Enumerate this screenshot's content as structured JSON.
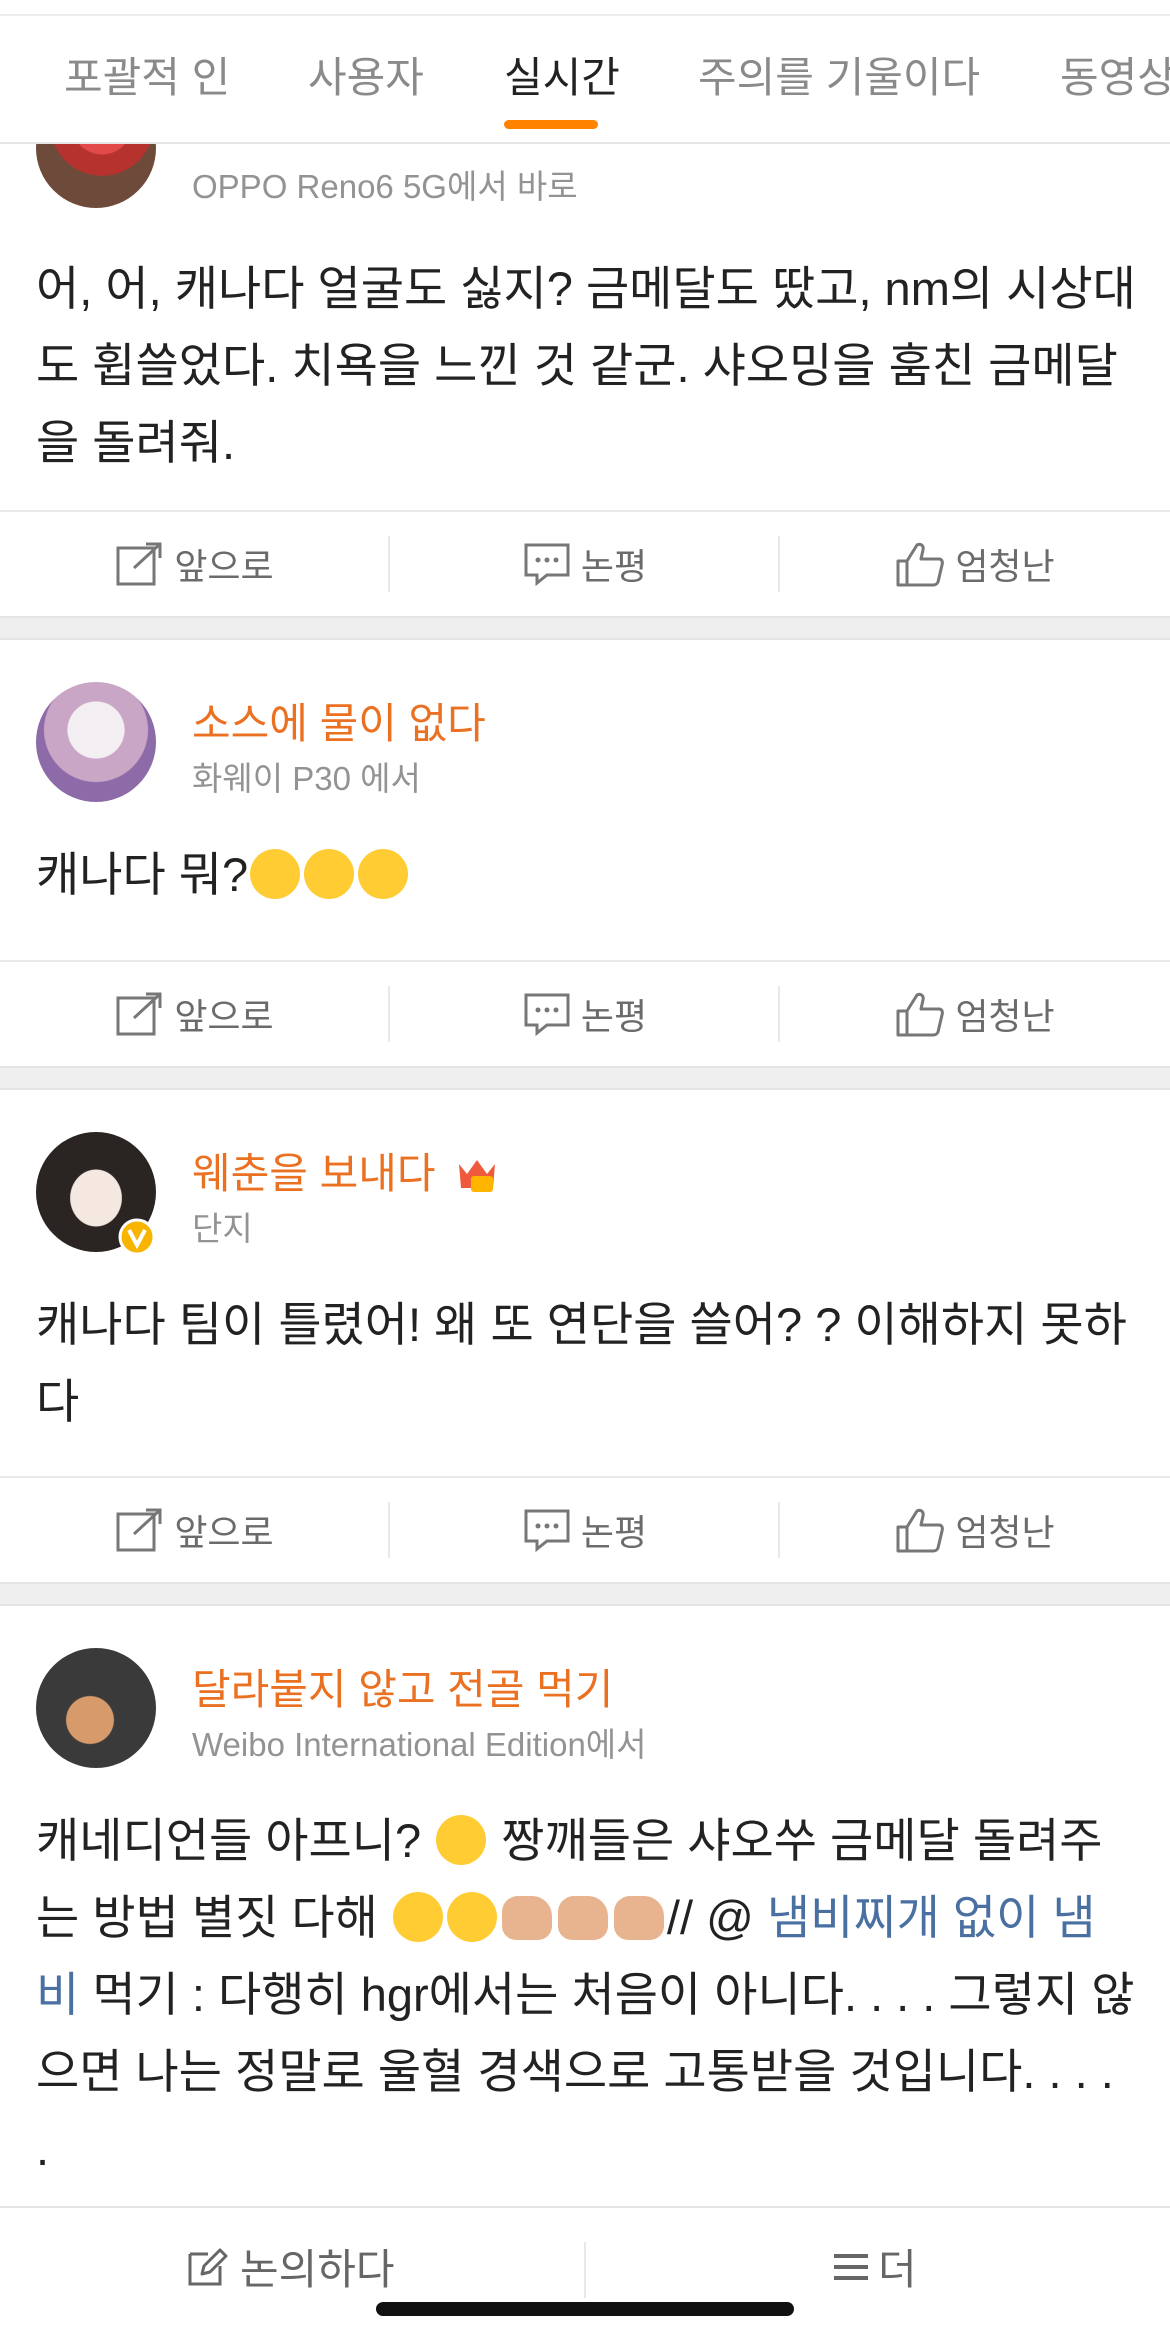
{
  "tabs": [
    {
      "label": "포괄적 인",
      "active": false
    },
    {
      "label": "사용자",
      "active": false
    },
    {
      "label": "실시간",
      "active": true
    },
    {
      "label": "주의를 기울이다",
      "active": false
    },
    {
      "label": "동영상",
      "active": false
    }
  ],
  "accent_color": "#ff8200",
  "name_color": "#eb7122",
  "posts": [
    {
      "source": "OPPO Reno6 5G에서 바로",
      "text": "어, 어, 캐나다 얼굴도 싫지? 금메달도 땄고, nm의 시상대도 휩쓸었다. 치욕을 느낀 것 같군. 샤오밍을 훔친 금메달을 돌려줘."
    },
    {
      "name": "소스에 물이 없다",
      "source": "화웨이 P30 에서",
      "text": "캐나다 뭐?"
    },
    {
      "name": "웨춘을 보내다",
      "source": "단지",
      "text": "캐나다 팀이 틀렸어! 왜 또 연단을 쓸어? ? 이해하지 못하다"
    },
    {
      "name": "달라붙지 않고 전골 먹기",
      "source": "Weibo International Edition에서",
      "text_a": "캐네디언들 아프니?",
      "text_b": "짱깨들은 샤오쑤 금메달 돌려주는 방법 별짓 다해",
      "text_c": "// @",
      "mention": "냄비찌개 없이 냄비",
      "text_d": "먹기 : 다행히 hgr에서는 처음이 아니다. . . . 그렇지 않으면 나는 정말로 울혈 경색으로 고통받을 것입니다. . . . ."
    }
  ],
  "actions": {
    "forward": "앞으로",
    "comment": "논평",
    "like": "엄청난"
  },
  "bottom": {
    "discuss": "논의하다",
    "more": "더"
  },
  "icons": [
    "forward-icon",
    "comment-icon",
    "like-icon",
    "edit-icon",
    "menu-icon",
    "verified-badge-icon",
    "crown-badge-icon"
  ]
}
